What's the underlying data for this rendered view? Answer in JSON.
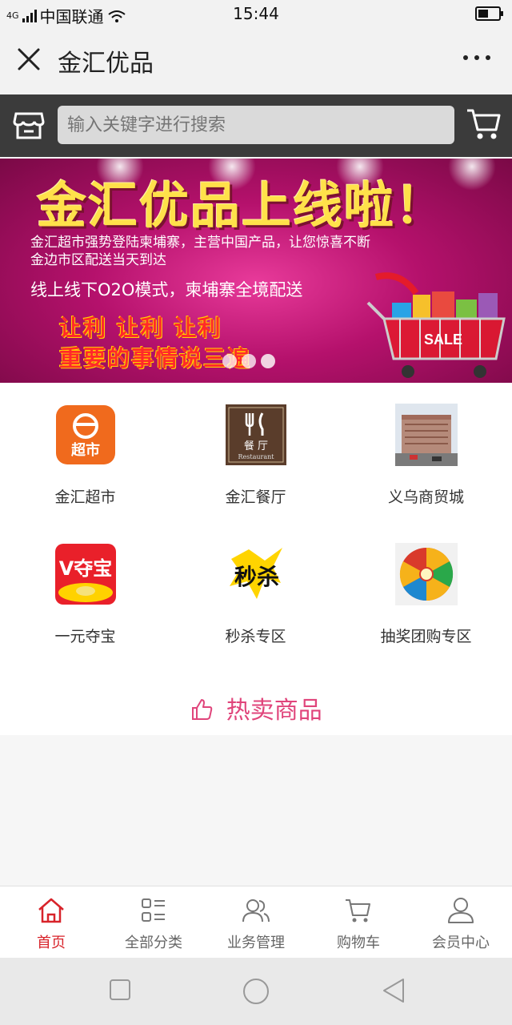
{
  "status_bar": {
    "network": "4G",
    "carrier": "中国联通",
    "time": "15:44"
  },
  "header": {
    "title": "金汇优品"
  },
  "search": {
    "placeholder": "输入关键字进行搜索"
  },
  "banner": {
    "headline": "金汇优品上线啦！",
    "line1": "金汇超市强势登陆柬埔寨，主营中国产品，让您惊喜不断",
    "line1b": "金边市区配送当天到达",
    "line2": "线上线下O2O模式，柬埔寨全境配送",
    "line3": "让利 让利 让利",
    "line4": "重要的事情说三遍",
    "sale_tag": "SALE",
    "slide_count": 3,
    "active_slide": 2
  },
  "categories": [
    {
      "label": "金汇超市",
      "icon": "supermarket-icon",
      "icon_text": "超市"
    },
    {
      "label": "金汇餐厅",
      "icon": "restaurant-icon",
      "icon_text": "餐 厅",
      "icon_subtext": "Restaurant"
    },
    {
      "label": "义乌商贸城",
      "icon": "mall-building-icon"
    },
    {
      "label": "一元夺宝",
      "icon": "treasure-icon",
      "icon_text": "V夺宝"
    },
    {
      "label": "秒杀专区",
      "icon": "flash-sale-icon",
      "icon_text": "秒杀"
    },
    {
      "label": "抽奖团购专区",
      "icon": "lottery-wheel-icon"
    }
  ],
  "hot_section": {
    "title": "热卖商品",
    "icon": "thumbs-up-icon"
  },
  "tabbar": {
    "items": [
      {
        "label": "首页",
        "icon": "home-icon",
        "active": true
      },
      {
        "label": "全部分类",
        "icon": "category-grid-icon",
        "active": false
      },
      {
        "label": "业务管理",
        "icon": "users-icon",
        "active": false
      },
      {
        "label": "购物车",
        "icon": "cart-icon",
        "active": false
      },
      {
        "label": "会员中心",
        "icon": "user-icon",
        "active": false
      }
    ]
  },
  "colors": {
    "accent": "#d8232a",
    "hot_title": "#e0457b",
    "search_bar_bg": "#3b3b3b",
    "banner_bg": "#b5116c"
  }
}
